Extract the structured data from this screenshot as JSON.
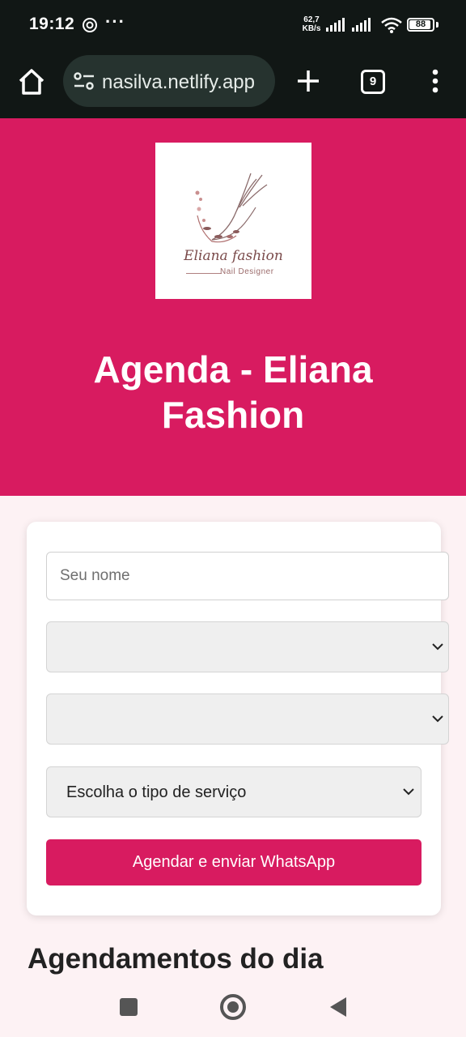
{
  "status_bar": {
    "time": "19:12",
    "app_icon": "openai-icon",
    "more": "···",
    "net_speed_value": "62,7",
    "net_speed_unit": "KB/s",
    "battery": "88"
  },
  "browser": {
    "url": "nasilva.netlify.app",
    "tabs_count": "9",
    "icons": [
      "home-icon",
      "tune-icon",
      "plus-icon",
      "more-vert-icon"
    ]
  },
  "header": {
    "logo_brand": "Eliana fashion",
    "logo_tagline": "Nail Designer",
    "title": "Agenda - Eliana Fashion",
    "background_color": "#d81b60"
  },
  "form": {
    "name_placeholder": "Seu nome",
    "select_1_value": "",
    "select_2_value": "",
    "service_select_value": "Escolha o tipo de serviço",
    "submit_label": "Agendar e enviar WhatsApp"
  },
  "section_title": "Agendamentos do dia",
  "nav": {
    "icons": [
      "recent-apps-icon",
      "home-circle-icon",
      "back-icon"
    ]
  }
}
